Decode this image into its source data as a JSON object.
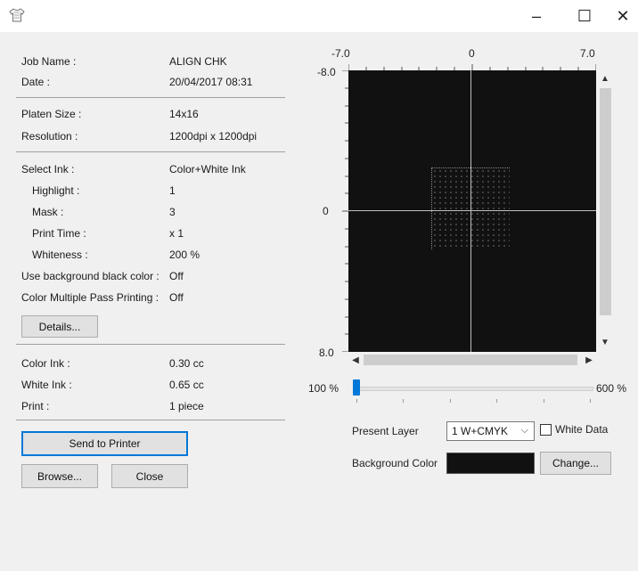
{
  "window": {
    "icon": "tshirt-icon",
    "min_glyph": "–",
    "max_glyph": "☐",
    "close_glyph": "✕"
  },
  "info": {
    "job_name": {
      "label": "Job Name :",
      "value": "ALIGN CHK"
    },
    "date": {
      "label": "Date :",
      "value": "20/04/2017 08:31"
    },
    "platen_size": {
      "label": "Platen Size :",
      "value": "14x16"
    },
    "resolution": {
      "label": "Resolution :",
      "value": "1200dpi x 1200dpi"
    },
    "select_ink": {
      "label": "Select Ink :",
      "value": "Color+White Ink"
    },
    "highlight": {
      "label": "Highlight :",
      "value": "1"
    },
    "mask": {
      "label": "Mask :",
      "value": "3"
    },
    "print_time": {
      "label": "Print Time :",
      "value": "x 1"
    },
    "whiteness": {
      "label": "Whiteness :",
      "value": "200 %"
    },
    "use_bg_black": {
      "label": "Use background black color :",
      "value": "Off"
    },
    "color_multipass": {
      "label": "Color Multiple Pass Printing :",
      "value": "Off"
    },
    "color_ink": {
      "label": "Color Ink :",
      "value": "0.30 cc"
    },
    "white_ink": {
      "label": "White Ink :",
      "value": "0.65 cc"
    },
    "print": {
      "label": "Print :",
      "value": "1 piece"
    }
  },
  "buttons": {
    "details": "Details...",
    "send_to_printer": "Send to Printer",
    "browse": "Browse...",
    "close": "Close",
    "change": "Change..."
  },
  "preview": {
    "x_left": "-7.0",
    "x_center": "0",
    "x_right": "7.0",
    "y_top": "-8.0",
    "y_center": "0",
    "y_bottom": "8.0",
    "zoom_min": "100 %",
    "zoom_max": "600 %",
    "zoom_value_percent": 100
  },
  "layer": {
    "present_layer_label": "Present Layer",
    "present_layer_value": "1 W+CMYK",
    "white_data_label": "White Data",
    "white_data_checked": false,
    "background_color_label": "Background Color",
    "background_color": "#111111"
  },
  "colors": {
    "accent": "#0078d7",
    "canvas": "#111111"
  }
}
